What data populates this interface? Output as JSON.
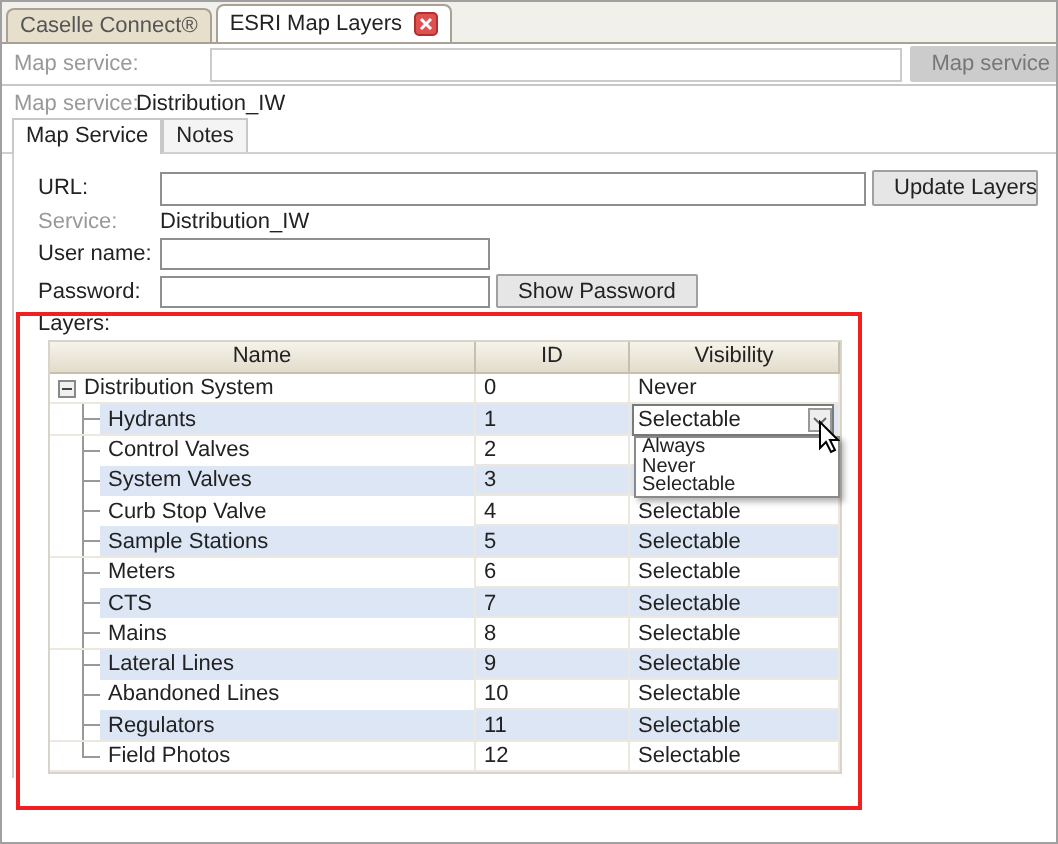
{
  "tabs": [
    {
      "label": "Caselle Connect®",
      "selected": false,
      "closable": false
    },
    {
      "label": "ESRI Map Layers",
      "selected": true,
      "closable": true
    }
  ],
  "service_bar": {
    "label": "Map service:",
    "button": "Map service",
    "disabled": true
  },
  "map_service": {
    "label": "Map service:",
    "value": "Distribution_IW"
  },
  "inner_tabs": [
    {
      "label": "Map Service",
      "selected": true
    },
    {
      "label": "Notes",
      "selected": false
    }
  ],
  "form": {
    "url_label": "URL:",
    "update_button": "Update Layers",
    "service_label": "Service:",
    "service_value": "Distribution_IW",
    "user_label": "User name:",
    "password_label": "Password:",
    "show_password_button": "Show Password"
  },
  "layers": {
    "label": "Layers:",
    "columns": [
      "Name",
      "ID",
      "Visibility"
    ],
    "rows": [
      {
        "name": "Distribution System",
        "id": "0",
        "visibility": "Never",
        "expanded": true,
        "children": [
          {
            "name": "Hydrants",
            "id": "1",
            "visibility": "Selectable",
            "editing": true
          },
          {
            "name": "Control Valves",
            "id": "2"
          },
          {
            "name": "System Valves",
            "id": "3"
          },
          {
            "name": "Curb Stop Valve",
            "id": "4",
            "visibility": "Selectable"
          },
          {
            "name": "Sample Stations",
            "id": "5",
            "visibility": "Selectable"
          },
          {
            "name": "Meters",
            "id": "6",
            "visibility": "Selectable"
          },
          {
            "name": "CTS",
            "id": "7",
            "visibility": "Selectable"
          },
          {
            "name": "Mains",
            "id": "8",
            "visibility": "Selectable"
          },
          {
            "name": "Lateral Lines",
            "id": "9",
            "visibility": "Selectable"
          },
          {
            "name": "Abandoned Lines",
            "id": "10",
            "visibility": "Selectable"
          },
          {
            "name": "Regulators",
            "id": "11",
            "visibility": "Selectable"
          },
          {
            "name": "Field Photos",
            "id": "12",
            "visibility": "Selectable"
          }
        ]
      }
    ],
    "dropdown_options": [
      "Always",
      "Never",
      "Selectable"
    ]
  }
}
